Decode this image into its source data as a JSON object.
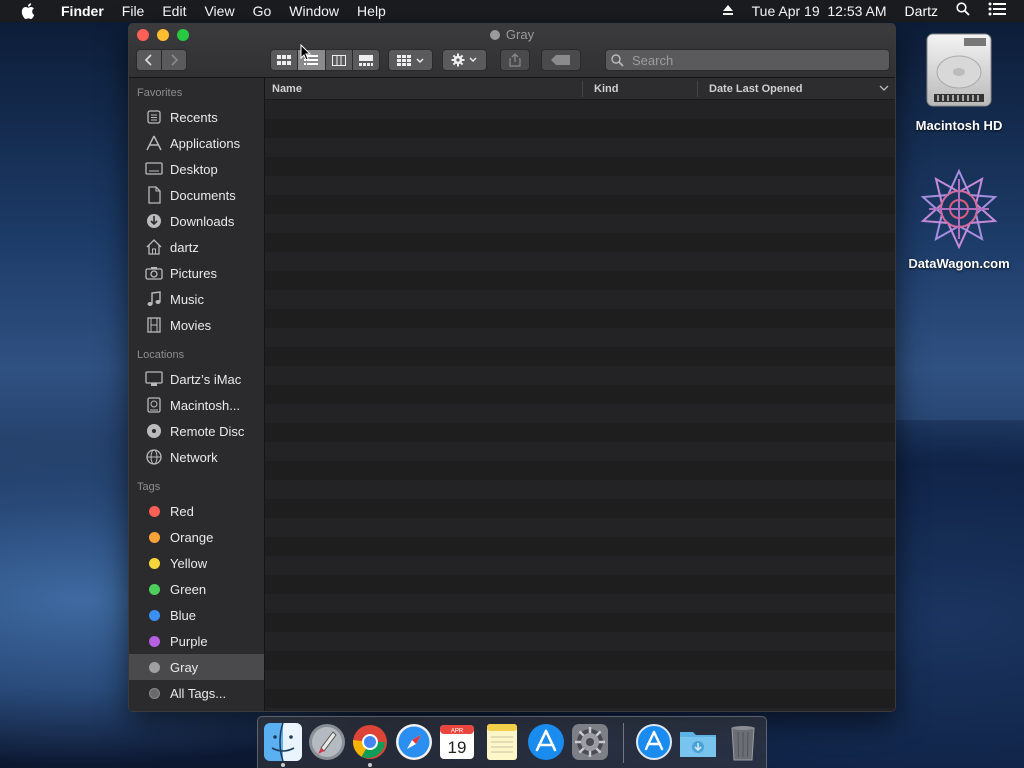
{
  "menubar": {
    "app_name": "Finder",
    "items": [
      "File",
      "Edit",
      "View",
      "Go",
      "Window",
      "Help"
    ],
    "datetime": "Tue Apr 19  12:53 AM",
    "user": "Dartz"
  },
  "window": {
    "title": "Gray",
    "title_tag_color": "#9a9a9a"
  },
  "toolbar": {
    "search_placeholder": "Search",
    "active_view": "list"
  },
  "sidebar": {
    "favorites_label": "Favorites",
    "favorites": [
      {
        "label": "Recents",
        "icon": "recents-icon"
      },
      {
        "label": "Applications",
        "icon": "applications-icon"
      },
      {
        "label": "Desktop",
        "icon": "desktop-icon"
      },
      {
        "label": "Documents",
        "icon": "documents-icon"
      },
      {
        "label": "Downloads",
        "icon": "downloads-icon"
      },
      {
        "label": "dartz",
        "icon": "home-icon"
      },
      {
        "label": "Pictures",
        "icon": "pictures-icon"
      },
      {
        "label": "Music",
        "icon": "music-icon"
      },
      {
        "label": "Movies",
        "icon": "movies-icon"
      }
    ],
    "locations_label": "Locations",
    "locations": [
      {
        "label": "Dartz’s iMac",
        "icon": "imac-icon"
      },
      {
        "label": "Macintosh...",
        "icon": "hard-drive-icon"
      },
      {
        "label": "Remote Disc",
        "icon": "disc-icon"
      },
      {
        "label": "Network",
        "icon": "network-icon"
      }
    ],
    "tags_label": "Tags",
    "tags": [
      {
        "label": "Red",
        "color": "#fe5f57"
      },
      {
        "label": "Orange",
        "color": "#f7a33a"
      },
      {
        "label": "Yellow",
        "color": "#f5d63b"
      },
      {
        "label": "Green",
        "color": "#4cd05b"
      },
      {
        "label": "Blue",
        "color": "#3b8ff2"
      },
      {
        "label": "Purple",
        "color": "#b560e0"
      },
      {
        "label": "Gray",
        "color": "#a0a0a0"
      },
      {
        "label": "All Tags...",
        "color": "#6a6a6a"
      }
    ],
    "selected": "Gray"
  },
  "columns": {
    "name": "Name",
    "kind": "Kind",
    "date_last_opened": "Date Last Opened"
  },
  "desktop": {
    "icons": [
      {
        "label": "Macintosh HD",
        "icon": "hard-drive-icon"
      },
      {
        "label": "DataWagon.com",
        "icon": "datawagon-icon"
      }
    ]
  },
  "dock": {
    "apps": [
      "Finder",
      "Launchpad",
      "Chrome",
      "Safari",
      "Calendar",
      "Notes",
      "App Store",
      "System Preferences",
      "App Store Downloads",
      "Downloads Folder",
      "Trash"
    ],
    "calendar_month": "APR",
    "calendar_day": "19"
  }
}
